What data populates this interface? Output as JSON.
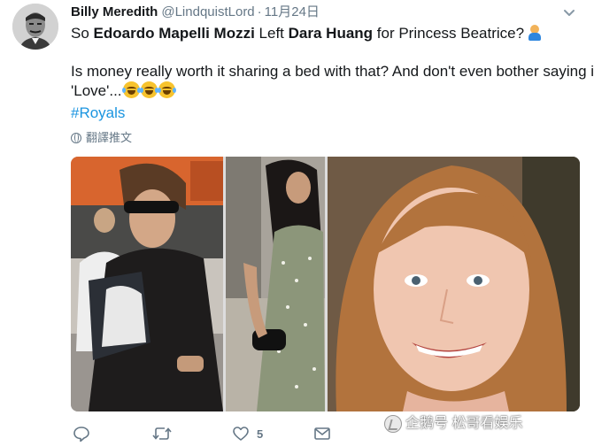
{
  "author": {
    "name": "Billy Meredith",
    "handle": "@LindquistLord",
    "separator": "·",
    "time": "11月24日"
  },
  "tweet": {
    "line1": {
      "p1": "So ",
      "b1": "Edoardo Mapelli Mozzi",
      "p2": " Left ",
      "b2": "Dara Huang",
      "p3": " for Princess Beatrice?"
    },
    "line2": "Is money really worth it sharing a bed with that? And don't even bother saying it's",
    "line3": "'Love'...",
    "hashtag": "#Royals",
    "emojis": [
      "face-with-tears-of-joy-emoji",
      "face-with-tears-of-joy-emoji",
      "face-with-tears-of-joy-emoji",
      "person-shrugging-emoji"
    ]
  },
  "translate": {
    "label": "翻譯推文",
    "icon": "globe-icon"
  },
  "media": {
    "panels": [
      "photo-man-with-baby-carrier",
      "photo-woman-green-dress",
      "photo-smiling-woman"
    ]
  },
  "actions": {
    "reply_icon": "reply-icon",
    "retweet_icon": "retweet-icon",
    "like_icon": "heart-icon",
    "like_count": "5",
    "dm_icon": "envelope-icon"
  },
  "watermark": {
    "text": "企鹅号 松哥看娱乐"
  },
  "colors": {
    "link": "#1b95e0",
    "secondary_text": "#657786",
    "primary_text": "#14171a"
  }
}
